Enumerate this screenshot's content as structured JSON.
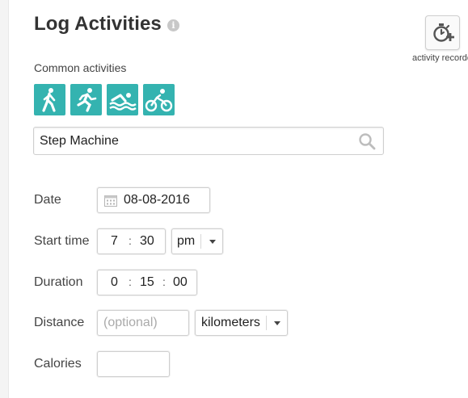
{
  "page": {
    "title": "Log Activities"
  },
  "common_activities": {
    "label": "Common activities",
    "items": [
      {
        "icon": "walking-icon"
      },
      {
        "icon": "running-icon"
      },
      {
        "icon": "swimming-icon"
      },
      {
        "icon": "cycling-icon"
      }
    ]
  },
  "search": {
    "value": "Step Machine",
    "icon": "search-icon"
  },
  "form": {
    "date": {
      "label": "Date",
      "value": "08-08-2016",
      "icon": "calendar-icon"
    },
    "start_time": {
      "label": "Start time",
      "hour": "7",
      "minute": "30",
      "separator": ":",
      "ampm": "pm"
    },
    "duration": {
      "label": "Duration",
      "hours": "0",
      "minutes": "15",
      "seconds": "00",
      "separator": ":"
    },
    "distance": {
      "label": "Distance",
      "placeholder": "(optional)",
      "unit": "kilometers"
    },
    "calories": {
      "label": "Calories",
      "value": ""
    }
  },
  "recorder": {
    "label": "activity recorder",
    "icon": "stopwatch-add-icon"
  },
  "colors": {
    "accent": "#34b3b0",
    "border": "#cfcfcf",
    "text": "#333333"
  }
}
